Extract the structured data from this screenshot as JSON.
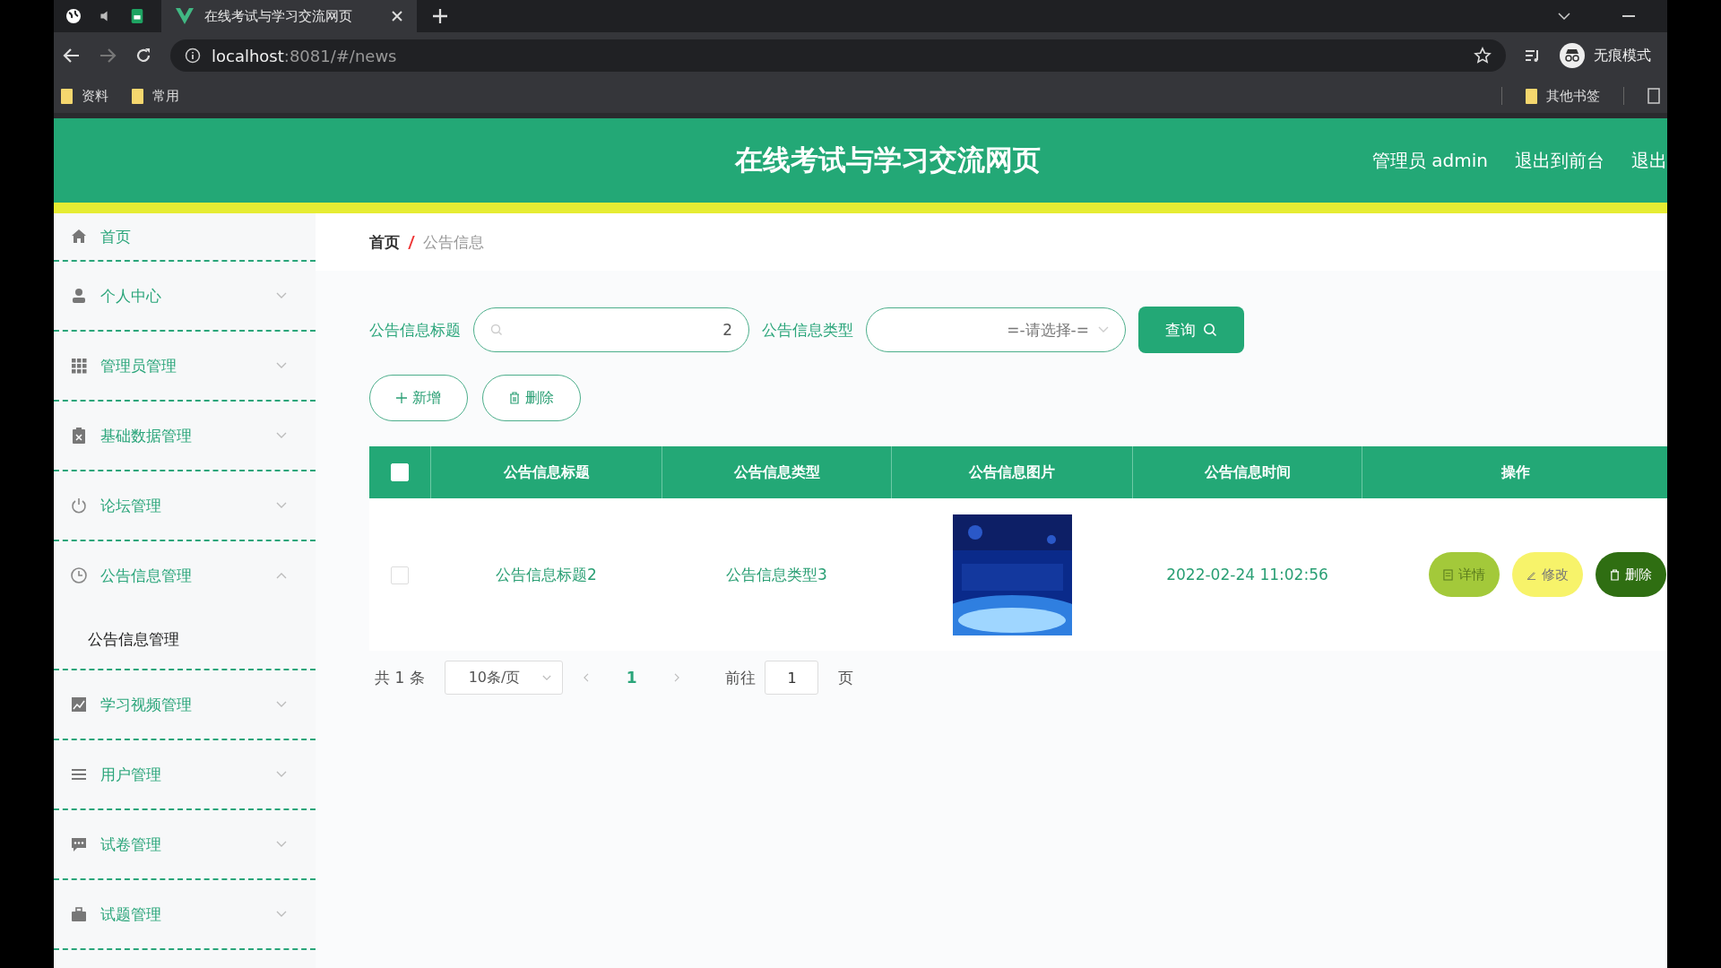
{
  "browser": {
    "tab_title": "在线考试与学习交流网页",
    "url_host": "localhost",
    "url_rest": ":8081/#/news",
    "profile": "无痕模式",
    "bookmarks": [
      "资料",
      "常用"
    ],
    "other_bookmarks": "其他书签"
  },
  "header": {
    "title": "在线考试与学习交流网页",
    "links": [
      "管理员 admin",
      "退出到前台",
      "退出"
    ]
  },
  "sidebar": {
    "items": [
      {
        "label": "首页",
        "kind": "link"
      },
      {
        "label": "个人中心",
        "kind": "menu",
        "expanded": false
      },
      {
        "label": "管理员管理",
        "kind": "menu",
        "expanded": false
      },
      {
        "label": "基础数据管理",
        "kind": "menu",
        "expanded": false
      },
      {
        "label": "论坛管理",
        "kind": "menu",
        "expanded": false
      },
      {
        "label": "公告信息管理",
        "kind": "menu",
        "expanded": true,
        "children": [
          {
            "label": "公告信息管理"
          }
        ]
      },
      {
        "label": "学习视频管理",
        "kind": "menu",
        "expanded": false
      },
      {
        "label": "用户管理",
        "kind": "menu",
        "expanded": false
      },
      {
        "label": "试卷管理",
        "kind": "menu",
        "expanded": false
      },
      {
        "label": "试题管理",
        "kind": "menu",
        "expanded": false
      }
    ]
  },
  "breadcrumb": [
    "首页",
    "公告信息"
  ],
  "search": {
    "title_label": "公告信息标题",
    "title_value": "2",
    "type_label": "公告信息类型",
    "type_placeholder": "=-请选择-=",
    "query_button": "查询"
  },
  "actions": [
    "新增",
    "删除"
  ],
  "table": {
    "select_all_checked": false,
    "columns": [
      "公告信息标题",
      "公告信息类型",
      "公告信息图片",
      "公告信息时间",
      "操作"
    ],
    "rows": [
      {
        "checked": false,
        "title": "公告信息标题2",
        "type": "公告信息类型3",
        "time": "2022-02-24 11:02:56",
        "buttons": [
          "详情",
          "修改",
          "删除"
        ]
      }
    ]
  },
  "pagination": {
    "total": "共 1 条",
    "page_size": "10条/页",
    "pages": [
      {
        "label": "1",
        "selected": true
      }
    ],
    "goto_label": "前往",
    "goto_value": "1",
    "goto_suffix": "页"
  }
}
